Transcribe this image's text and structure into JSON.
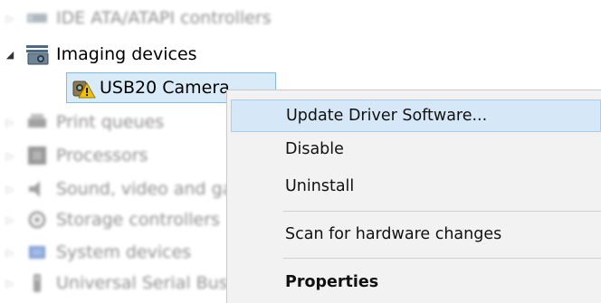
{
  "tree": {
    "categories": [
      {
        "label": "IDE ATA/ATAPI controllers",
        "icon": "ide-controller-icon",
        "expanded": false,
        "blurred": true
      },
      {
        "label": "Imaging devices",
        "icon": "imaging-device-icon",
        "expanded": true,
        "blurred": false
      },
      {
        "label": "Print queues",
        "icon": "printer-icon",
        "expanded": false,
        "blurred": true
      },
      {
        "label": "Processors",
        "icon": "processor-icon",
        "expanded": false,
        "blurred": true
      },
      {
        "label": "Sound, video and game controllers",
        "icon": "speaker-icon",
        "expanded": false,
        "blurred": true
      },
      {
        "label": "Storage controllers",
        "icon": "storage-controller-icon",
        "expanded": false,
        "blurred": true
      },
      {
        "label": "System devices",
        "icon": "system-device-icon",
        "expanded": false,
        "blurred": true
      },
      {
        "label": "Universal Serial Bus controllers",
        "icon": "usb-icon",
        "expanded": false,
        "blurred": true
      }
    ],
    "selected_device": {
      "label": "USB20 Camera",
      "icon": "camera-warning-icon",
      "status": "warning"
    }
  },
  "context_menu": {
    "items": [
      {
        "label": "Update Driver Software...",
        "highlighted": true,
        "bold": false
      },
      {
        "label": "Disable",
        "highlighted": false,
        "bold": false
      },
      {
        "label": "Uninstall",
        "highlighted": false,
        "bold": false
      },
      {
        "label": "Scan for hardware changes",
        "highlighted": false,
        "bold": false
      },
      {
        "label": "Properties",
        "highlighted": false,
        "bold": true
      }
    ]
  },
  "colors": {
    "selection_bg": "#d9ebf9",
    "selection_border": "#7fbcec",
    "menu_bg": "#f2f2f2",
    "menu_highlight": "#d6e8f8",
    "warning": "#f2c200"
  }
}
